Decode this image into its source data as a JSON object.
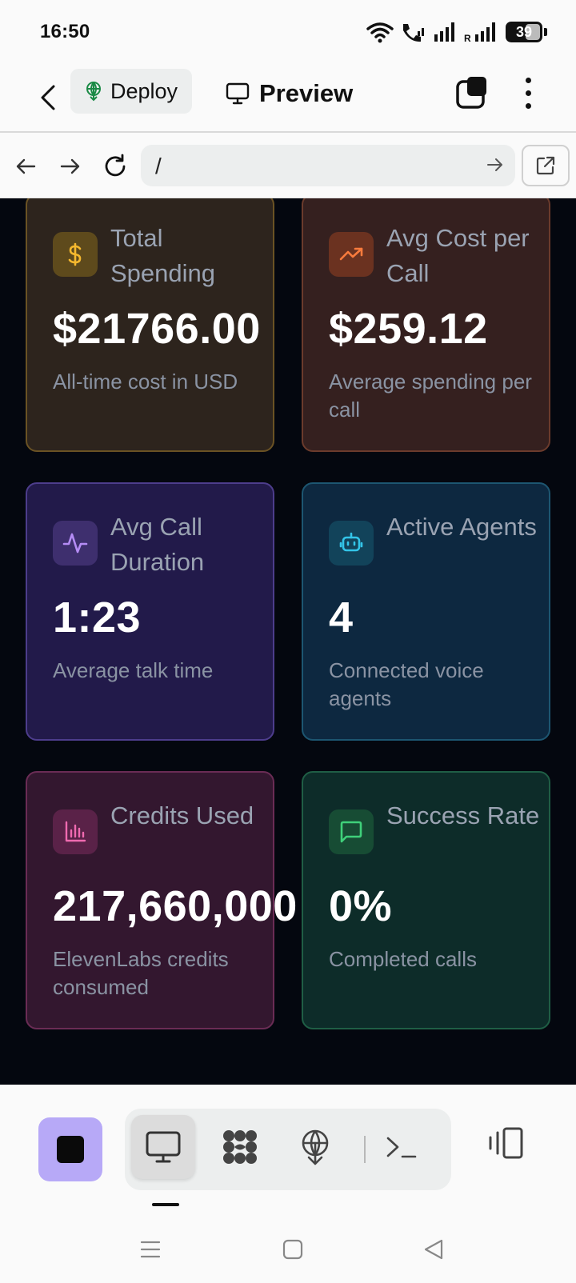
{
  "status_bar": {
    "time": "16:50",
    "battery": "39"
  },
  "header": {
    "deploy_label": "Deploy",
    "preview_label": "Preview"
  },
  "browser": {
    "url": "/"
  },
  "cards": [
    {
      "title": "Total Spending",
      "value": "$21766.00",
      "desc": "All-time cost in USD",
      "icon": "dollar-icon",
      "accent": "#f5b82e"
    },
    {
      "title": "Avg Cost per Call",
      "value": "$259.12",
      "desc": "Average spending per call",
      "icon": "trending-up-icon",
      "accent": "#f97b3d"
    },
    {
      "title": "Avg Call Duration",
      "value": "1:23",
      "desc": "Average talk time",
      "icon": "activity-icon",
      "accent": "#b58cf5"
    },
    {
      "title": "Active Agents",
      "value": "4",
      "desc": "Connected voice agents",
      "icon": "bot-icon",
      "accent": "#33c4e8"
    },
    {
      "title": "Credits Used",
      "value": "217,660,000",
      "desc": "ElevenLabs credits consumed",
      "icon": "bar-chart-icon",
      "accent": "#ef6ab0"
    },
    {
      "title": "Success Rate",
      "value": "0%",
      "desc": "Completed calls",
      "icon": "message-square-icon",
      "accent": "#3fd07a"
    }
  ]
}
